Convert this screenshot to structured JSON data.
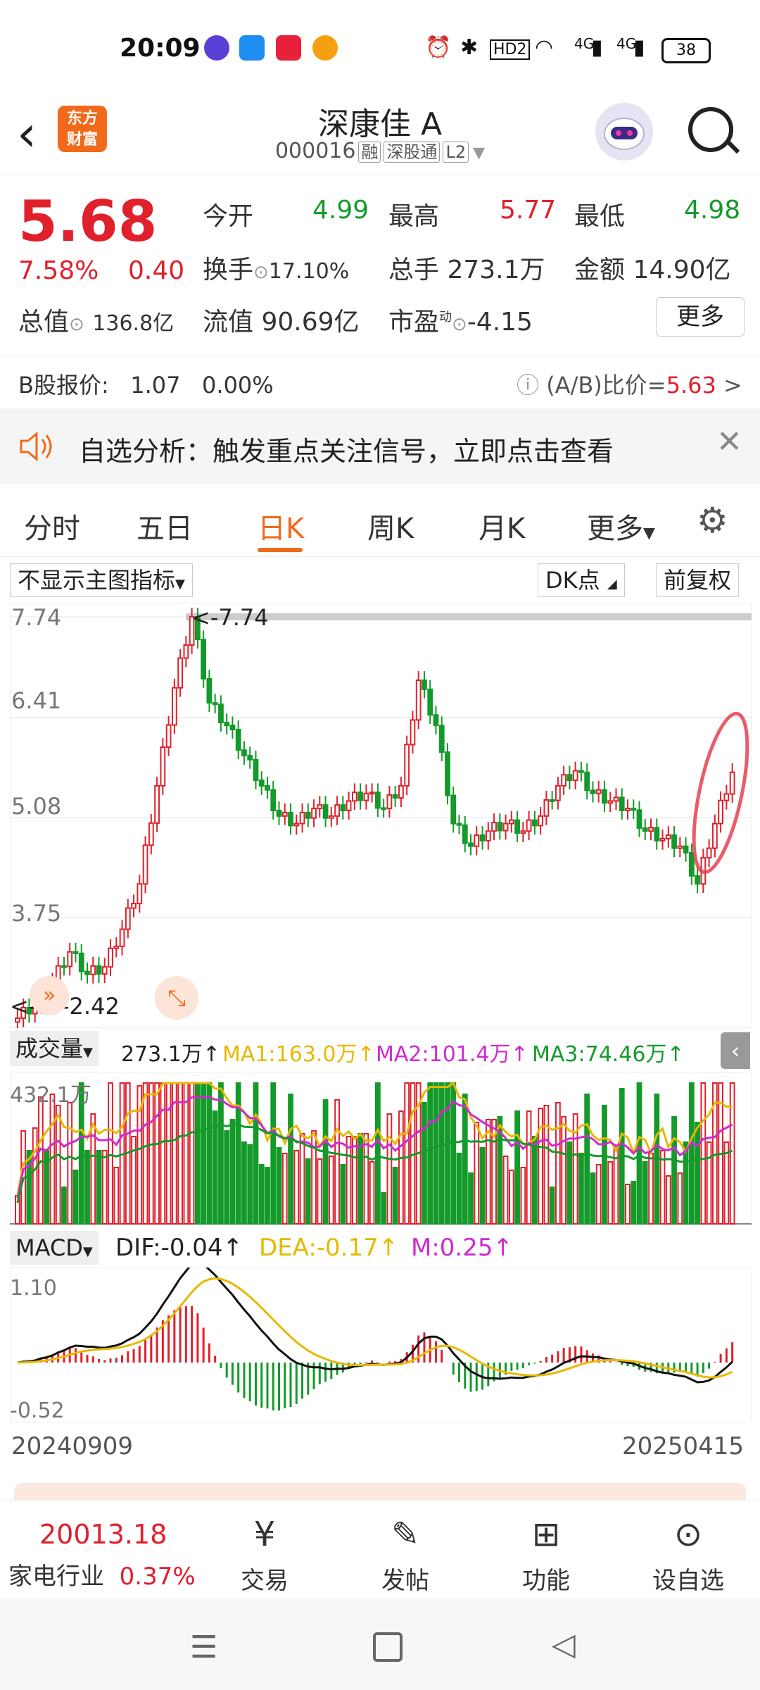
{
  "status_bar": {
    "time": "20:09",
    "battery": "38",
    "net1": "4G",
    "net2": "4G",
    "hd": "HD2"
  },
  "header": {
    "stock_name": "深康佳 A",
    "code": "000016",
    "tags": [
      "融",
      "深股通",
      "L2"
    ],
    "logo_line1": "东方",
    "logo_line2": "财富"
  },
  "quote": {
    "price": "5.68",
    "change_pct": "7.58%",
    "change": "0.40",
    "open_label": "今开",
    "open": "4.99",
    "high_label": "最高",
    "high": "5.77",
    "low_label": "最低",
    "low": "4.98",
    "turnover_label": "换手",
    "turnover": "17.10%",
    "volume_label": "总手",
    "volume": "273.1万",
    "amount_label": "金额",
    "amount": "14.90亿",
    "mktcap_label": "总值",
    "mktcap": "136.8亿",
    "float_label": "流值",
    "float": "90.69亿",
    "pe_label": "市盈",
    "pe_sup": "动",
    "pe": "-4.15",
    "more": "更多"
  },
  "bshare": {
    "label": "B股报价:",
    "price": "1.07",
    "pct": "0.00%",
    "ratio_label": "(A/B)比价=",
    "ratio": "5.63",
    "arrow": ">"
  },
  "notice": {
    "text": "自选分析：触发重点关注信号，立即点击查看"
  },
  "tabs": [
    "分时",
    "五日",
    "日K",
    "周K",
    "月K",
    "更多"
  ],
  "active_tab": "日K",
  "chart_controls": {
    "indicator": "不显示主图指标",
    "dk": "DK点",
    "adjust": "前复权"
  },
  "candlestick": {
    "y_labels": [
      "7.74",
      "6.41",
      "5.08",
      "3.75"
    ],
    "max_marker": "<-7.74",
    "min_marker": "<-----2.42",
    "min_partial_label": "2"
  },
  "volume_panel": {
    "label": "成交量",
    "value": "273.1万",
    "arrow": "↑",
    "ma1": "MA1:163.0万",
    "ma2": "MA2:101.4万",
    "ma3": "MA3:74.46万",
    "y_label": "432.1万"
  },
  "macd_panel": {
    "label": "MACD",
    "dif": "DIF:-0.04",
    "dea": "DEA:-0.17",
    "m": "M:0.25",
    "arrow": "↑",
    "y_top": "1.10",
    "y_bottom": "-0.52"
  },
  "dates": {
    "start": "20240909",
    "end": "20250415"
  },
  "bottom_bar": {
    "index_value": "20013.18",
    "industry": "家电行业",
    "industry_pct": "0.37%",
    "items": [
      "交易",
      "发帖",
      "功能",
      "设自选"
    ]
  },
  "colors": {
    "up": "#e0202b",
    "down": "#149a2a",
    "accent": "#f06a1a",
    "ma1": "#e8b800",
    "ma2": "#d02ad0",
    "ma3": "#149a2a"
  },
  "chart_data": {
    "type": "candlestick",
    "x_range": [
      "20240909",
      "20250415"
    ],
    "ylim": [
      2.42,
      7.74
    ],
    "closes_sampled": [
      2.42,
      2.6,
      2.9,
      3.3,
      3.0,
      3.1,
      3.6,
      4.2,
      5.5,
      6.8,
      7.74,
      6.6,
      6.3,
      5.9,
      5.5,
      5.1,
      5.0,
      5.2,
      5.1,
      5.3,
      5.4,
      5.2,
      5.5,
      6.9,
      6.3,
      5.0,
      4.7,
      4.9,
      5.0,
      4.9,
      5.1,
      5.5,
      5.7,
      5.4,
      5.3,
      5.2,
      4.9,
      4.8,
      4.7,
      4.2,
      5.0,
      5.68
    ]
  }
}
